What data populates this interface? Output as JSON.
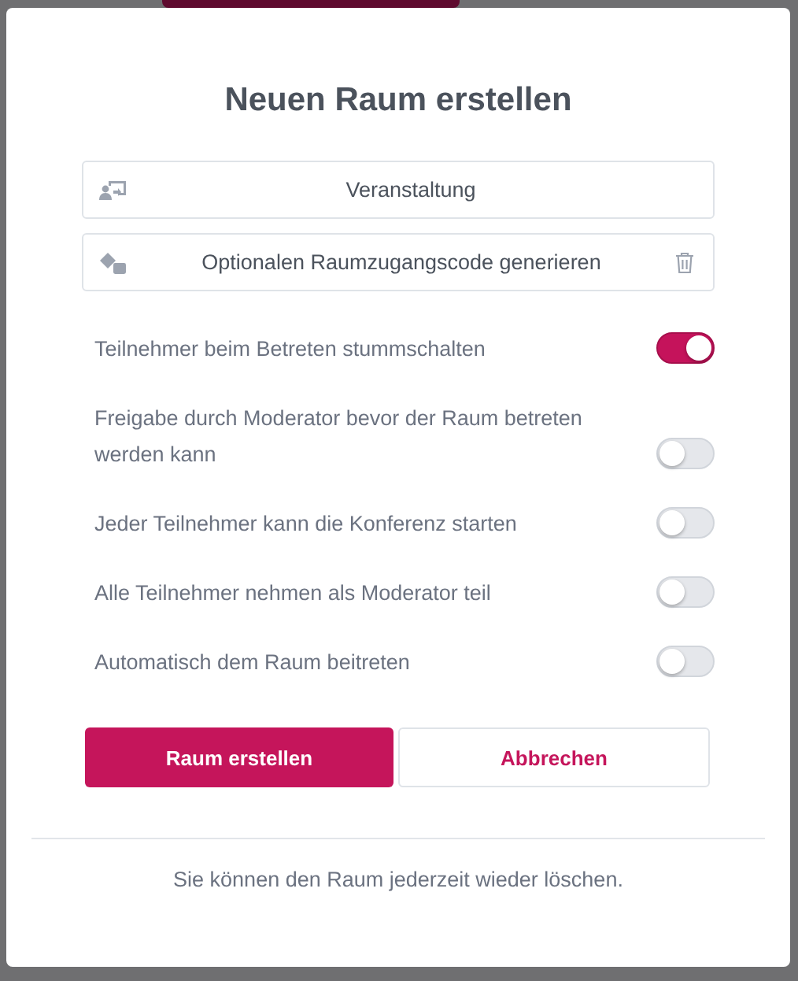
{
  "dialog": {
    "title": "Neuen Raum erstellen",
    "fields": [
      {
        "kind": "type",
        "value": "Veranstaltung"
      },
      {
        "kind": "code",
        "value": "Optionalen Raumzugangscode generieren"
      }
    ],
    "options": [
      {
        "label": "Teilnehmer beim Betreten stummschalten",
        "on": true
      },
      {
        "label": "Freigabe durch Moderator bevor der Raum betreten werden kann",
        "on": false
      },
      {
        "label": "Jeder Teilnehmer kann die Konferenz starten",
        "on": false
      },
      {
        "label": "Alle Teilnehmer nehmen als Moderator teil",
        "on": false
      },
      {
        "label": "Automatisch dem Raum beitreten",
        "on": false
      }
    ],
    "buttons": [
      {
        "kind": "primary",
        "label": "Raum erstellen"
      },
      {
        "kind": "secondary",
        "label": "Abbrechen"
      }
    ],
    "note": "Sie können den Raum jederzeit wieder löschen."
  }
}
